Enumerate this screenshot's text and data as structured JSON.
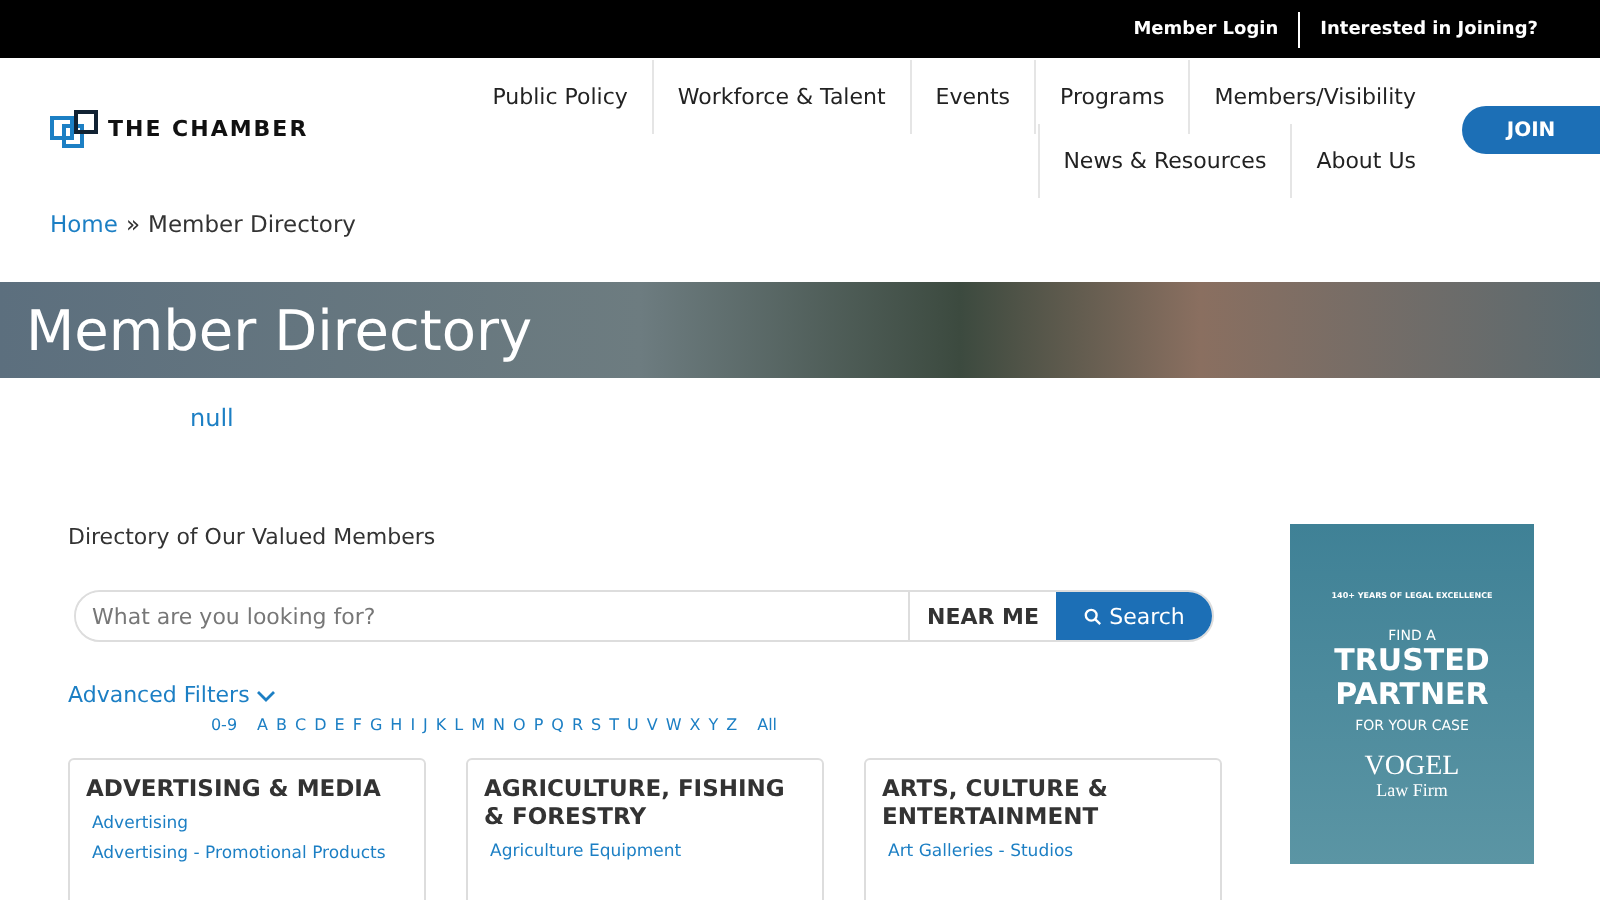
{
  "top_bar": {
    "links": [
      "Member Login",
      "Interested in Joining?"
    ]
  },
  "header": {
    "logo": "THE CHAMBER",
    "nav_rows": [
      [
        "Public Policy",
        "Workforce & Talent",
        "Events",
        "Programs",
        "Members/Visibility"
      ],
      [
        "News & Resources",
        "About Us"
      ]
    ],
    "join_button": "JOIN"
  },
  "breadcrumb": {
    "home": "Home",
    "separator": "»",
    "current": "Member Directory"
  },
  "hero": {
    "title": "Member Directory"
  },
  "null_link": "null",
  "directory": {
    "heading": "Directory of Our Valued Members",
    "search": {
      "placeholder": "What are you looking for?",
      "near_me": "NEAR ME",
      "button": "Search"
    },
    "advanced_filters": "Advanced Filters",
    "letters": [
      "0-9",
      "A",
      "B",
      "C",
      "D",
      "E",
      "F",
      "G",
      "H",
      "I",
      "J",
      "K",
      "L",
      "M",
      "N",
      "O",
      "P",
      "Q",
      "R",
      "S",
      "T",
      "U",
      "V",
      "W",
      "X",
      "Y",
      "Z",
      "All"
    ],
    "categories": [
      {
        "title": "ADVERTISING & MEDIA",
        "items": [
          "Advertising",
          "Advertising - Promotional Products"
        ]
      },
      {
        "title": "AGRICULTURE, FISHING & FORESTRY",
        "items": [
          "Agriculture Equipment"
        ]
      },
      {
        "title": "ARTS, CULTURE & ENTERTAINMENT",
        "items": [
          "Art Galleries - Studios"
        ]
      }
    ]
  },
  "ad": {
    "tagline": "140+ YEARS OF LEGAL EXCELLENCE",
    "line_1": "FIND A",
    "line_2": "TRUSTED",
    "line_3": "PARTNER",
    "line_4": "FOR YOUR CASE",
    "brand": "VOGEL",
    "brand_sub": "Law Firm"
  }
}
